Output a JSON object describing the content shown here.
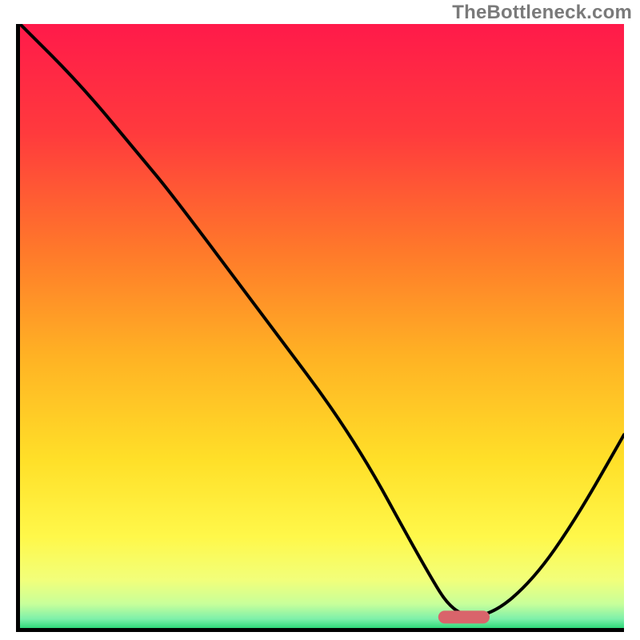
{
  "watermark": "TheBottleneck.com",
  "chart_data": {
    "type": "line",
    "title": "",
    "xlabel": "",
    "ylabel": "",
    "xlim": [
      0,
      1
    ],
    "ylim": [
      0,
      1
    ],
    "series": [
      {
        "name": "bottleneck-curve",
        "x": [
          0.0,
          0.1,
          0.2,
          0.25,
          0.4,
          0.55,
          0.67,
          0.72,
          0.78,
          0.85,
          0.92,
          1.0
        ],
        "y": [
          1.0,
          0.9,
          0.78,
          0.72,
          0.52,
          0.32,
          0.1,
          0.02,
          0.02,
          0.08,
          0.18,
          0.32
        ]
      }
    ],
    "marker": {
      "name": "optimal-range",
      "x_center": 0.735,
      "width": 0.085,
      "y": 0.018,
      "color": "#d9646b"
    },
    "gradient_stops": [
      {
        "pos": 0.0,
        "color": "#ff1a4a"
      },
      {
        "pos": 0.18,
        "color": "#ff3a3d"
      },
      {
        "pos": 0.38,
        "color": "#ff7a2a"
      },
      {
        "pos": 0.55,
        "color": "#ffb224"
      },
      {
        "pos": 0.72,
        "color": "#ffdf28"
      },
      {
        "pos": 0.85,
        "color": "#fff84a"
      },
      {
        "pos": 0.92,
        "color": "#f2ff7a"
      },
      {
        "pos": 0.96,
        "color": "#c8ff9a"
      },
      {
        "pos": 0.985,
        "color": "#7ef0aa"
      },
      {
        "pos": 1.0,
        "color": "#2fd87a"
      }
    ]
  }
}
